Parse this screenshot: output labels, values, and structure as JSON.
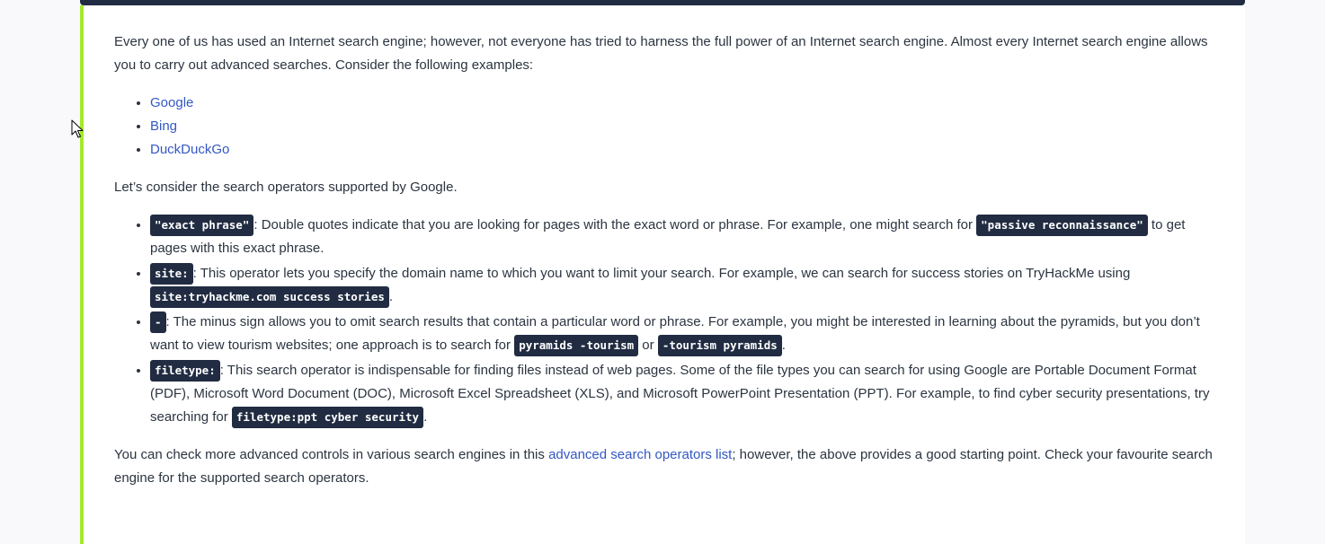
{
  "intro": "Every one of us has used an Internet search engine; however, not everyone has tried to harness the full power of an Internet search engine. Almost every Internet search engine allows you to carry out advanced searches. Consider the following examples:",
  "engines": [
    "Google",
    "Bing",
    "DuckDuckGo"
  ],
  "lead": "Let’s consider the search operators supported by Google.",
  "operators": {
    "exact": {
      "code": "\"exact phrase\"",
      "text1": ": Double quotes indicate that you are looking for pages with the exact word or phrase. For example, one might search for ",
      "code2": "\"passive reconnaissance\"",
      "text2": " to get pages with this exact phrase."
    },
    "site": {
      "code": "site:",
      "text1": ": This operator lets you specify the domain name to which you want to limit your search. For example, we can search for success stories on TryHackMe using ",
      "code2": "site:tryhackme.com success stories",
      "text2": "."
    },
    "minus": {
      "code": "-",
      "text1": ": The minus sign allows you to omit search results that contain a particular word or phrase. For example, you might be interested in learning about the pyramids, but you don’t want to view tourism websites; one approach is to search for ",
      "code2": "pyramids -tourism",
      "text2": " or ",
      "code3": "-tourism pyramids",
      "text3": "."
    },
    "filetype": {
      "code": "filetype:",
      "text1": ": This search operator is indispensable for finding files instead of web pages. Some of the file types you can search for using Google are Portable Document Format (PDF), Microsoft Word Document (DOC), Microsoft Excel Spreadsheet (XLS), and Microsoft PowerPoint Presentation (PPT). For example, to find cyber security presentations, try searching for ",
      "code2": "filetype:ppt cyber security",
      "text2": "."
    }
  },
  "closing": {
    "before": "You can check more advanced controls in various search engines in this ",
    "link": "advanced search operators list",
    "after": "; however, the above provides a good starting point. Check your favourite search engine for the supported search operators."
  },
  "colors": {
    "accent_border": "#a3ea2a",
    "code_bg": "#212c42",
    "link": "#3358c4",
    "text": "#2b3440"
  }
}
